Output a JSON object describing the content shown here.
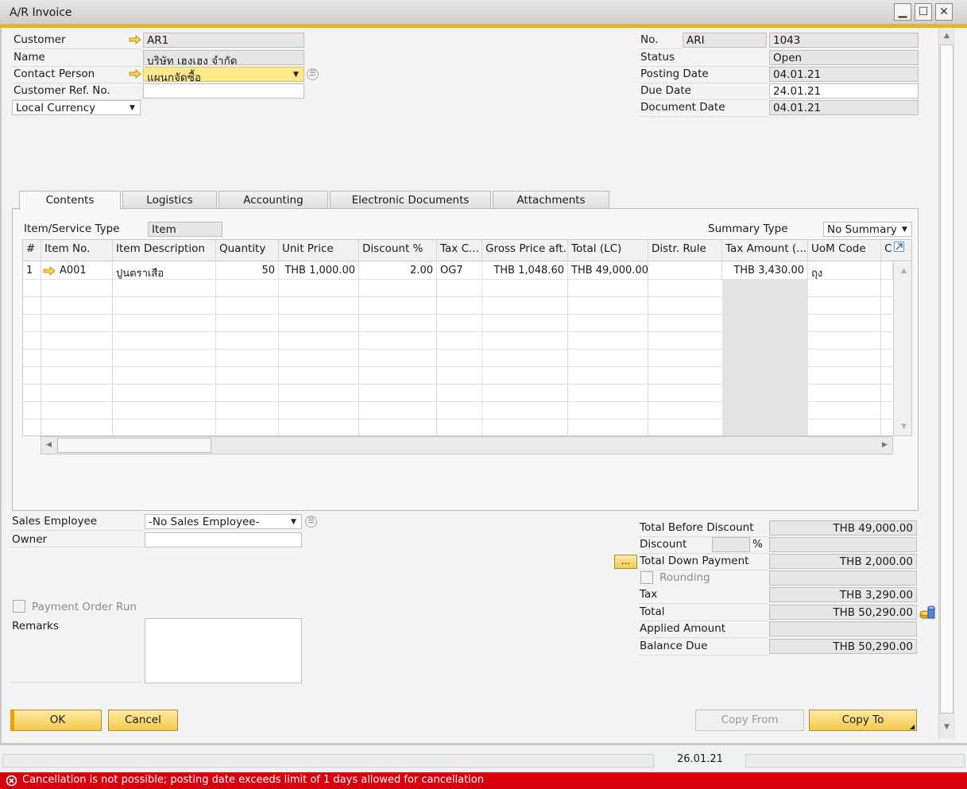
{
  "window": {
    "title": "A/R Invoice",
    "accent_color": "#f0b400"
  },
  "header_left": {
    "customer_label": "Customer",
    "customer_value": "AR1",
    "name_label": "Name",
    "name_value": "บริษัท เฮงเฮง จำกัด",
    "contact_label": "Contact Person",
    "contact_value": "แผนกจัดซื้อ",
    "ref_label": "Customer Ref. No.",
    "ref_value": "",
    "currency_value": "Local Currency"
  },
  "header_right": {
    "no_label": "No.",
    "series_value": "ARI",
    "no_value": "1043",
    "status_label": "Status",
    "status_value": "Open",
    "posting_label": "Posting Date",
    "posting_value": "04.01.21",
    "due_label": "Due Date",
    "due_value": "24.01.21",
    "docdate_label": "Document Date",
    "docdate_value": "04.01.21"
  },
  "tabs": [
    "Contents",
    "Logistics",
    "Accounting",
    "Electronic Documents",
    "Attachments"
  ],
  "contents": {
    "item_type_label": "Item/Service Type",
    "item_type_value": "Item",
    "summary_label": "Summary Type",
    "summary_value": "No Summary",
    "columns": [
      "#",
      "Item No.",
      "Item Description",
      "Quantity",
      "Unit Price",
      "Discount %",
      "Tax C...",
      "Gross Price aft...",
      "Total (LC)",
      "Distr. Rule",
      "Tax Amount (...",
      "UoM Code",
      "C"
    ],
    "rows": [
      [
        "1",
        "A001",
        "ปูนตราเสือ",
        "50",
        "THB 1,000.00",
        "2.00",
        "OG7",
        "THB 1,048.60",
        "THB 49,000.00",
        "",
        "THB 3,430.00",
        "ถุง",
        ""
      ]
    ]
  },
  "footer_left": {
    "sales_emp_label": "Sales Employee",
    "sales_emp_value": "-No Sales Employee-",
    "owner_label": "Owner",
    "owner_value": "",
    "payment_run_label": "Payment Order Run",
    "remarks_label": "Remarks",
    "remarks_value": ""
  },
  "totals": {
    "before_discount_label": "Total Before Discount",
    "before_discount_value": "THB 49,000.00",
    "discount_label": "Discount",
    "discount_pct": "",
    "percent_sign": "%",
    "discount_value": "",
    "down_payment_label": "Total Down Payment",
    "down_payment_value": "THB 2,000.00",
    "dots_label": "...",
    "rounding_label": "Rounding",
    "rounding_value": "",
    "tax_label": "Tax",
    "tax_value": "THB 3,290.00",
    "total_label": "Total",
    "total_value": "THB 50,290.00",
    "applied_label": "Applied Amount",
    "applied_value": "",
    "balance_label": "Balance Due",
    "balance_value": "THB 50,290.00"
  },
  "buttons": {
    "ok": "OK",
    "cancel": "Cancel",
    "copy_from": "Copy From",
    "copy_to": "Copy To"
  },
  "statusbar": {
    "date": "26.01.21",
    "error_message": "Cancellation is not possible; posting date exceeds limit of 1 days allowed for cancellation",
    "error_color": "#d7000f"
  },
  "icons": [
    "link-arrow-icon",
    "dropdown-arrow-icon",
    "choose-icon",
    "expand-icon",
    "error-icon",
    "coins-icon",
    "minimize-icon",
    "maximize-icon",
    "close-icon"
  ]
}
